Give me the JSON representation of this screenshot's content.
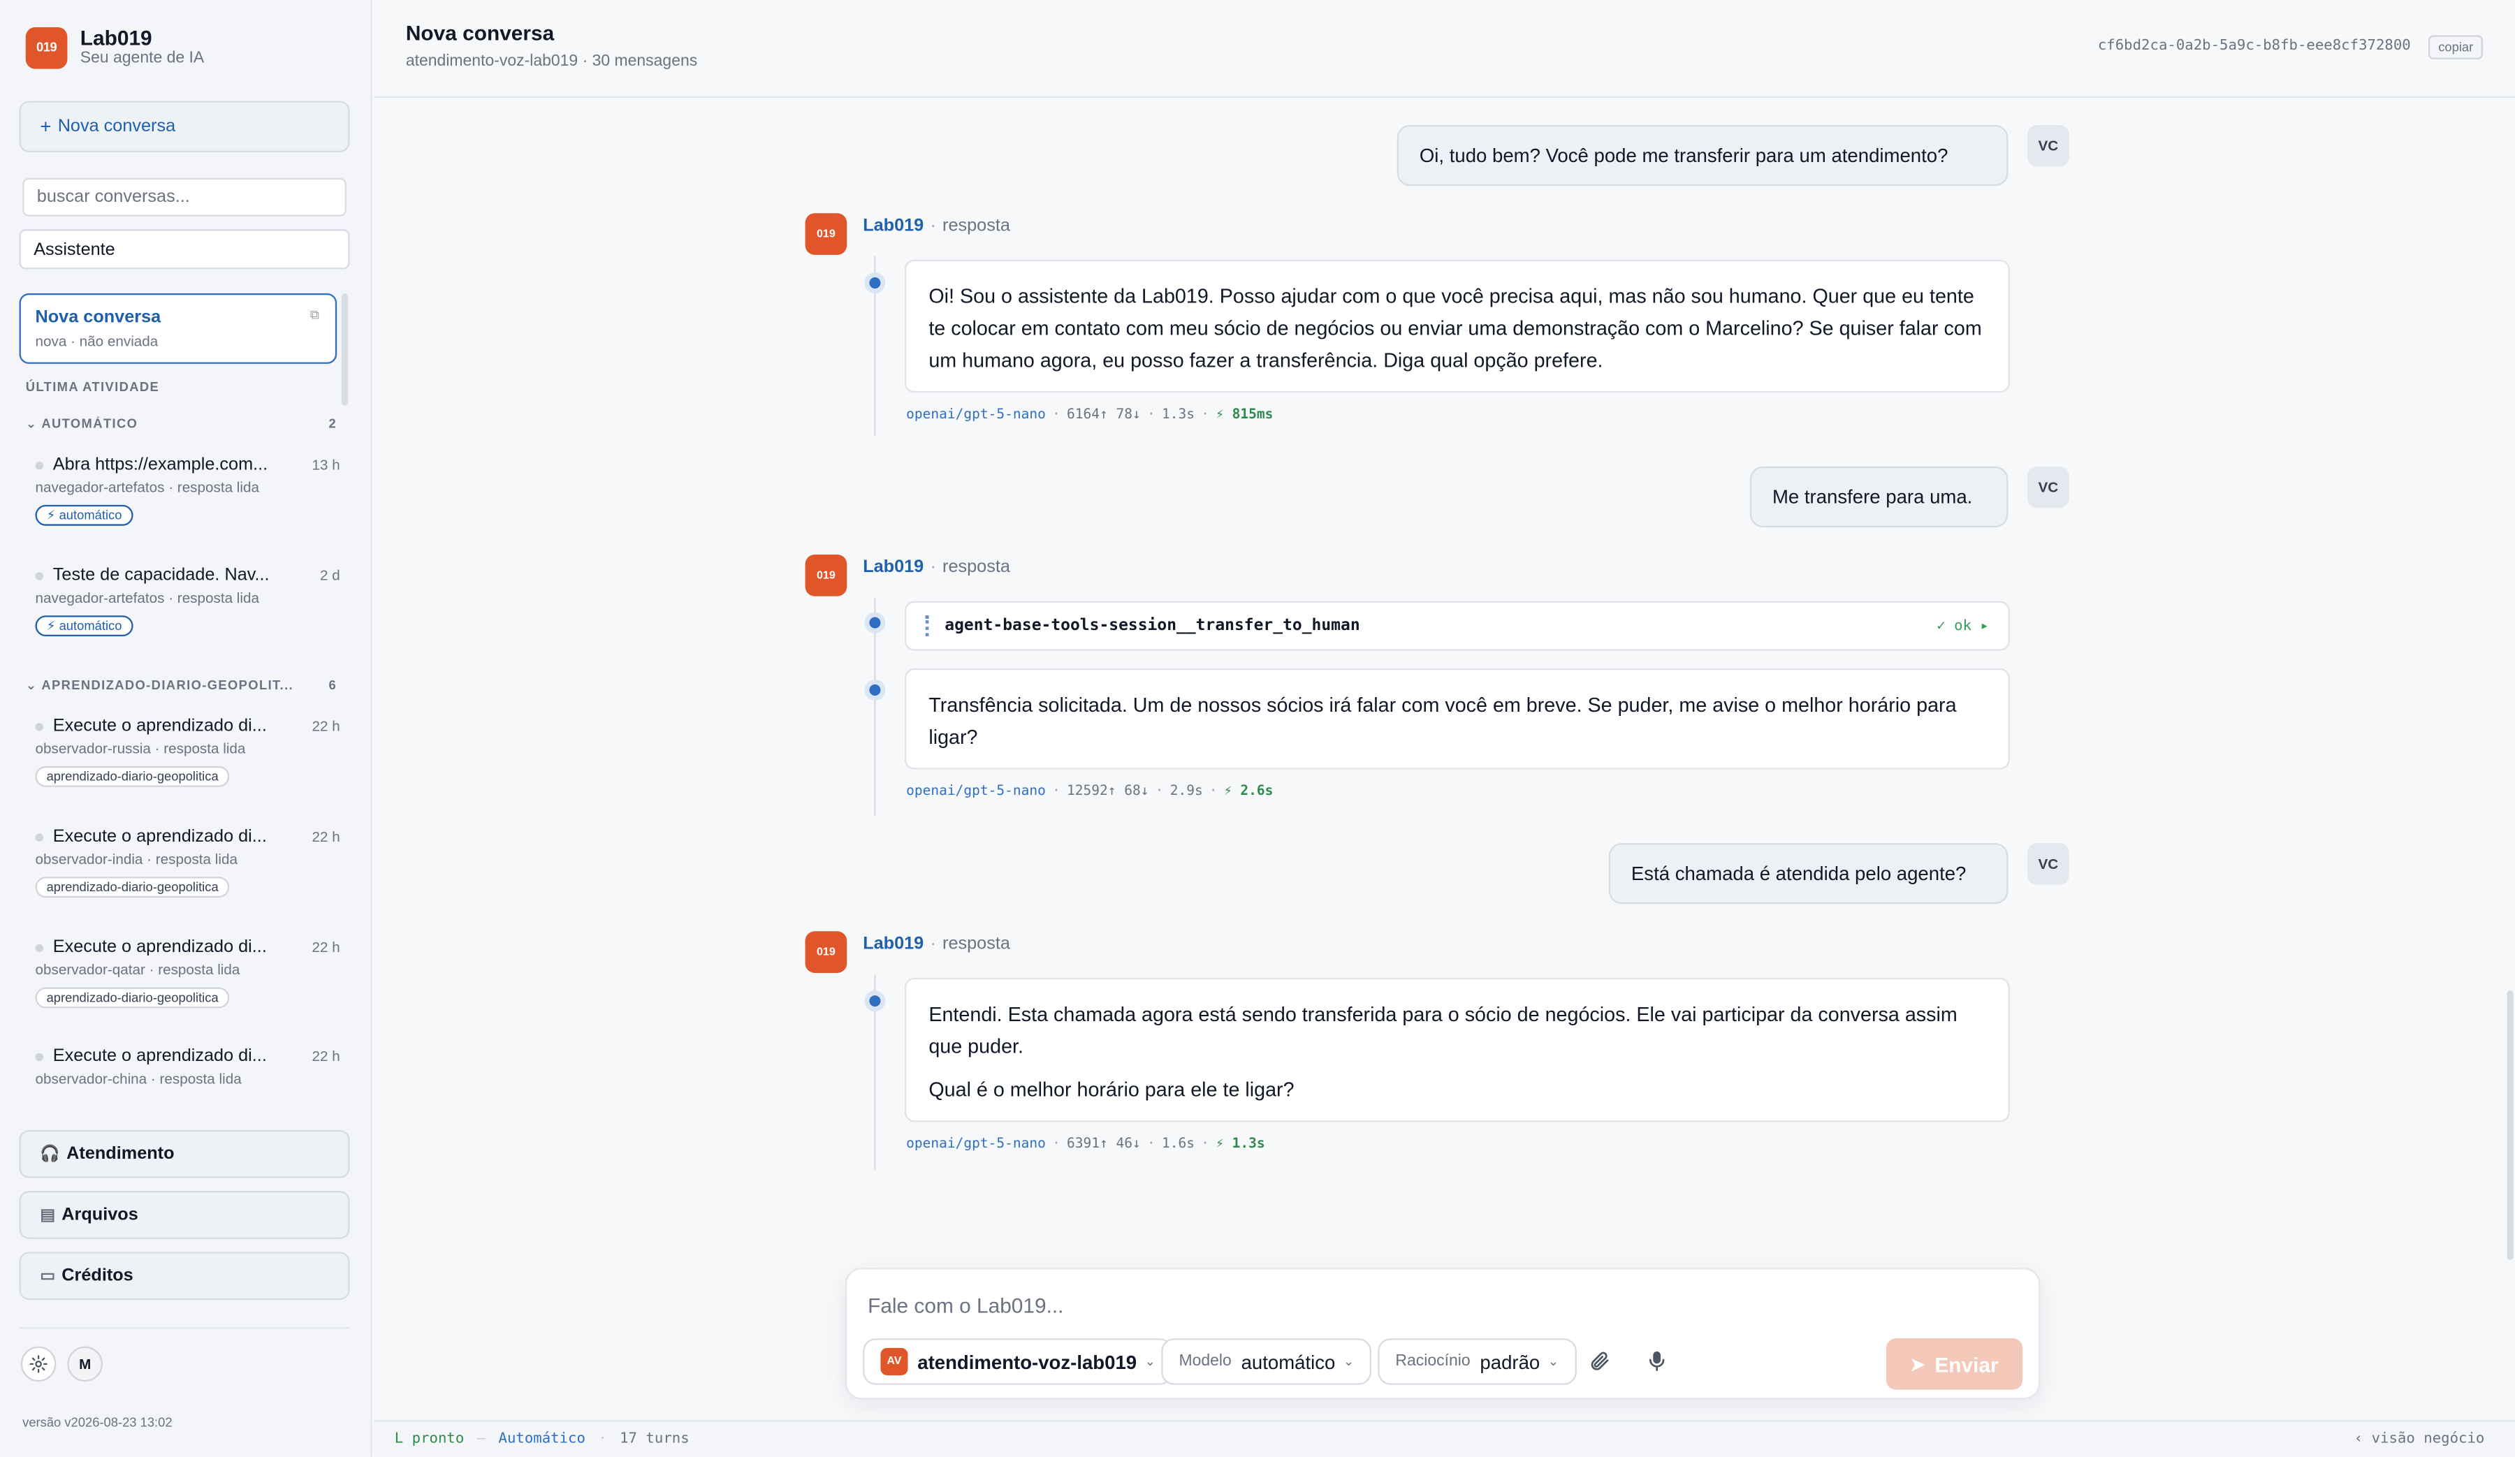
{
  "app": {
    "logo_text": "019",
    "name": "Lab019",
    "tagline": "Seu agente de IA",
    "brand_color": "#e0562a",
    "accent_color": "#2f6fc1"
  },
  "sidebar": {
    "new_conversation": "Nova conversa",
    "search_placeholder": "buscar conversas...",
    "agent_select": "Assistente",
    "active_conversation": {
      "title": "Nova conversa",
      "subtitle": "nova · não enviada"
    },
    "section_label": "ÚLTIMA ATIVIDADE",
    "groups": [
      {
        "label": "AUTOMÁTICO",
        "count": "2",
        "items": [
          {
            "title": "Abra https://example.com...",
            "time": "13 h",
            "meta": "navegador-artefatos · resposta lida",
            "tag": "⚡ automático"
          },
          {
            "title": "Teste de capacidade. Nav...",
            "time": "2 d",
            "meta": "navegador-artefatos · resposta lida",
            "tag": "⚡ automático"
          }
        ]
      },
      {
        "label": "APRENDIZADO-DIARIO-GEOPOLIT...",
        "count": "6",
        "items": [
          {
            "title": "Execute o aprendizado di...",
            "time": "22 h",
            "meta": "observador-russia · resposta lida",
            "tag": "aprendizado-diario-geopolitica"
          },
          {
            "title": "Execute o aprendizado di...",
            "time": "22 h",
            "meta": "observador-india · resposta lida",
            "tag": "aprendizado-diario-geopolitica"
          },
          {
            "title": "Execute o aprendizado di...",
            "time": "22 h",
            "meta": "observador-qatar · resposta lida",
            "tag": "aprendizado-diario-geopolitica"
          },
          {
            "title": "Execute o aprendizado di...",
            "time": "22 h",
            "meta": "observador-china · resposta lida",
            "tag": ""
          }
        ]
      }
    ],
    "nav": [
      {
        "label": "Atendimento",
        "icon": "headset-icon"
      },
      {
        "label": "Arquivos",
        "icon": "folder-icon"
      },
      {
        "label": "Créditos",
        "icon": "card-icon"
      }
    ],
    "user_initial": "M",
    "version": "versão v2026-08-23 13:02"
  },
  "header": {
    "title": "Nova conversa",
    "subtitle": "atendimento-voz-lab019 · 30 mensagens",
    "conversation_id": "cf6bd2ca-0a2b-5a9c-b8fb-eee8cf372800",
    "copy_label": "copiar"
  },
  "messages": {
    "user_initials": "VC",
    "agent_name": "Lab019",
    "agent_role": "resposta",
    "user_1": "Oi, tudo bem? Você pode me transferir para um atendimento?",
    "reply_1": "Oi! Sou o assistente da Lab019. Posso ajudar com o que você precisa aqui, mas não sou humano. Quer que eu tente te colocar em contato com meu sócio de negócios ou enviar uma demonstração com o Marcelino? Se quiser falar com um humano agora, eu posso fazer a transferência. Diga qual opção prefere.",
    "meta_1": {
      "model": "openai/gpt-5-nano",
      "tokens": "6164↑ 78↓",
      "duration": "1.3s",
      "latency": "⚡ 815ms"
    },
    "user_2": "Me transfere para uma.",
    "tool_call": "agent-base-tools-session__transfer_to_human",
    "tool_status": "✓ ok ▸",
    "reply_2": "Transfência solicitada. Um de nossos sócios irá falar com você em breve. Se puder, me avise o melhor horário para ligar?",
    "meta_2": {
      "model": "openai/gpt-5-nano",
      "tokens": "12592↑ 68↓",
      "duration": "2.9s",
      "latency": "⚡ 2.6s"
    },
    "user_3": "Está chamada é atendida pelo agente?",
    "reply_3_p1": "Entendi. Esta chamada agora está sendo transferida para o sócio de negócios. Ele vai participar da conversa assim que puder.",
    "reply_3_p2": "Qual é o melhor horário para ele te ligar?",
    "meta_3": {
      "model": "openai/gpt-5-nano",
      "tokens": "6391↑ 46↓",
      "duration": "1.6s",
      "latency": "⚡ 1.3s"
    }
  },
  "composer": {
    "placeholder": "Fale com o Lab019...",
    "agent_badge": "AV",
    "agent_name": "atendimento-voz-lab019",
    "model_label": "Modelo",
    "model_value": "automático",
    "reasoning_label": "Raciocínio",
    "reasoning_value": "padrão",
    "send_label": "Enviar"
  },
  "footer": {
    "status": "L pronto",
    "mode": "Automático",
    "turns": "17 turns",
    "view": "‹ visão negócio"
  }
}
